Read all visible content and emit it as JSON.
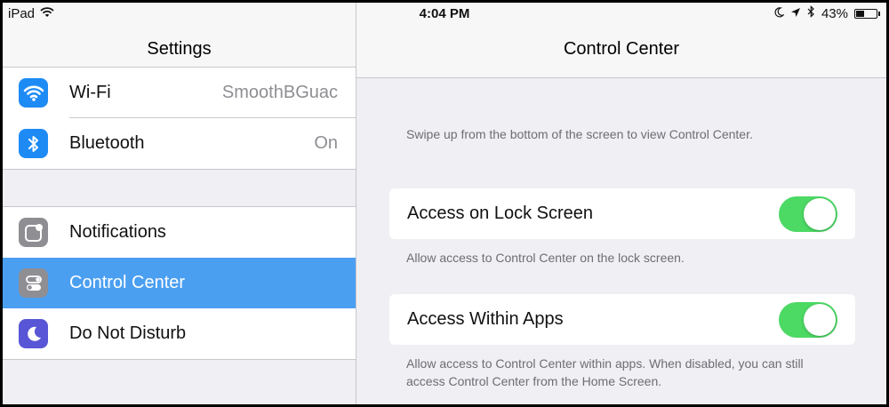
{
  "status_bar": {
    "device": "iPad",
    "time": "4:04 PM",
    "battery": "43%",
    "battery_level": 0.43,
    "icons": [
      "wifi-icon",
      "moon-icon",
      "location-arrow-icon",
      "bluetooth-icon",
      "battery-icon"
    ]
  },
  "master": {
    "title": "Settings",
    "group1": [
      {
        "label": "Wi-Fi",
        "value": "SmoothBGuac",
        "icon": "wifi-icon",
        "color": "#1e8bf5"
      },
      {
        "label": "Bluetooth",
        "value": "On",
        "icon": "bluetooth-icon",
        "color": "#1e8bf5"
      }
    ],
    "group2": [
      {
        "label": "Notifications",
        "icon": "notifications-icon",
        "color": "#8e8e93"
      },
      {
        "label": "Control Center",
        "icon": "control-center-icon",
        "color": "#8e8e93",
        "selected": true
      },
      {
        "label": "Do Not Disturb",
        "icon": "moon-icon",
        "color": "#5856d6"
      }
    ]
  },
  "detail": {
    "title": "Control Center",
    "intro": "Swipe up from the bottom of the screen to view Control Center.",
    "settings": [
      {
        "label": "Access on Lock Screen",
        "on": true,
        "footer": "Allow access to Control Center on the lock screen."
      },
      {
        "label": "Access Within Apps",
        "on": true,
        "footer": "Allow access to Control Center within apps. When disabled, you can still access Control Center from the Home Screen."
      }
    ]
  },
  "colors": {
    "selection": "#4b9ff1",
    "toggle_on": "#4cd964",
    "accent_blue": "#1e8bf5",
    "dnd_purple": "#5856d6"
  }
}
